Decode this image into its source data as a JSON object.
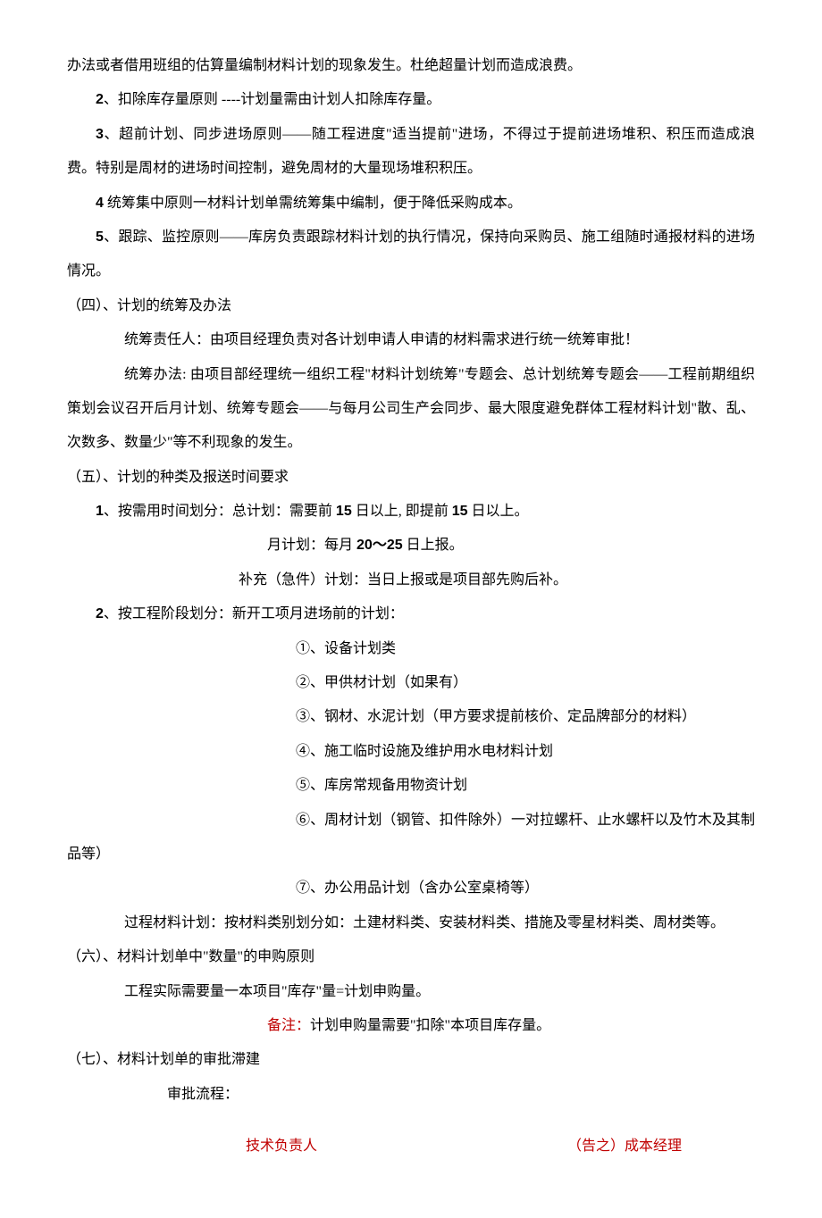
{
  "p1": "办法或者借用班组的估算量编制材料计划的现象发生。杜绝超量计划而造成浪费。",
  "p2_num": "2",
  "p2": "、扣除库存量原则 ----计划量需由计划人扣除库存量。",
  "p3_num": "3",
  "p3": "、超前计划、同步进场原则——随工程进度\"适当提前\"进场，不得过于提前进场堆积、积压而造成浪费。特别是周材的进场时间控制，避免周材的大量现场堆积积压。",
  "p4_num": "4",
  "p4": " 统筹集中原则一材料计划单需统筹集中编制，便于降低采购成本。",
  "p5_num": "5",
  "p5": "、跟踪、监控原则——库房负责跟踪材料计划的执行情况，保持向采购员、施工组随时通报材料的进场情况。",
  "s4_title": "（四）、计划的统筹及办法",
  "s4_p1": "统筹责任人：由项目经理负责对各计划申请人申请的材料需求进行统一统筹审批！",
  "s4_p2": "统筹办法: 由项目部经理统一组织工程\"材料计划统筹\"专题会、总计划统筹专题会——工程前期组织策划会议召开后月计划、统筹专题会——与每月公司生产会同步、最大限度避免群体工程材料计划\"散、乱、次数多、数量少\"等不利现象的发生。",
  "s5_title": "（五）、计划的种类及报送时间要求",
  "s5_p1_num": "1",
  "s5_p1a": "、按需用时间划分：总计划：需要前 ",
  "s5_p1_15a": "15",
  "s5_p1b": " 日以上, 即提前 ",
  "s5_p1_15b": "15",
  "s5_p1c": " 日以上。",
  "s5_p2a": "月计划：每月 ",
  "s5_p2_range": "20～25",
  "s5_p2b": " 日上报。",
  "s5_p3": "补充（急件）计划：当日上报或是项目部先购后补。",
  "s5_p4_num": "2",
  "s5_p4": "、按工程阶段划分：新开工项月进场前的计划：",
  "s5_li1": "①、设备计划类",
  "s5_li2": "②、甲供材计划（如果有）",
  "s5_li3": "③、钢材、水泥计划（甲方要求提前核价、定品牌部分的材料）",
  "s5_li4": "④、施工临时设施及维护用水电材料计划",
  "s5_li5": "⑤、库房常规备用物资计划",
  "s5_li6": "⑥、周材计划（钢管、扣件除外）一对拉螺杆、止水螺杆以及竹木及其制品等）",
  "s5_li7": "⑦、办公用品计划（含办公室桌椅等）",
  "s5_p5": "过程材料计划：按材料类别划分如：土建材料类、安装材料类、措施及零星材料类、周材类等。",
  "s6_title": "（六）、材料计划单中\"数量\"的申购原则",
  "s6_p1": "工程实际需要量一本项目\"库存\"量=计划申购量。",
  "s6_note_label": "备注：",
  "s6_note_text": "计划申购量需要\"扣除\"本项目库存量。",
  "s7_title": "（七）、材料计划单的审批滞建",
  "s7_p1": "审批流程：",
  "flow_left": "技术负责人",
  "flow_right": "（告之）成本经理"
}
